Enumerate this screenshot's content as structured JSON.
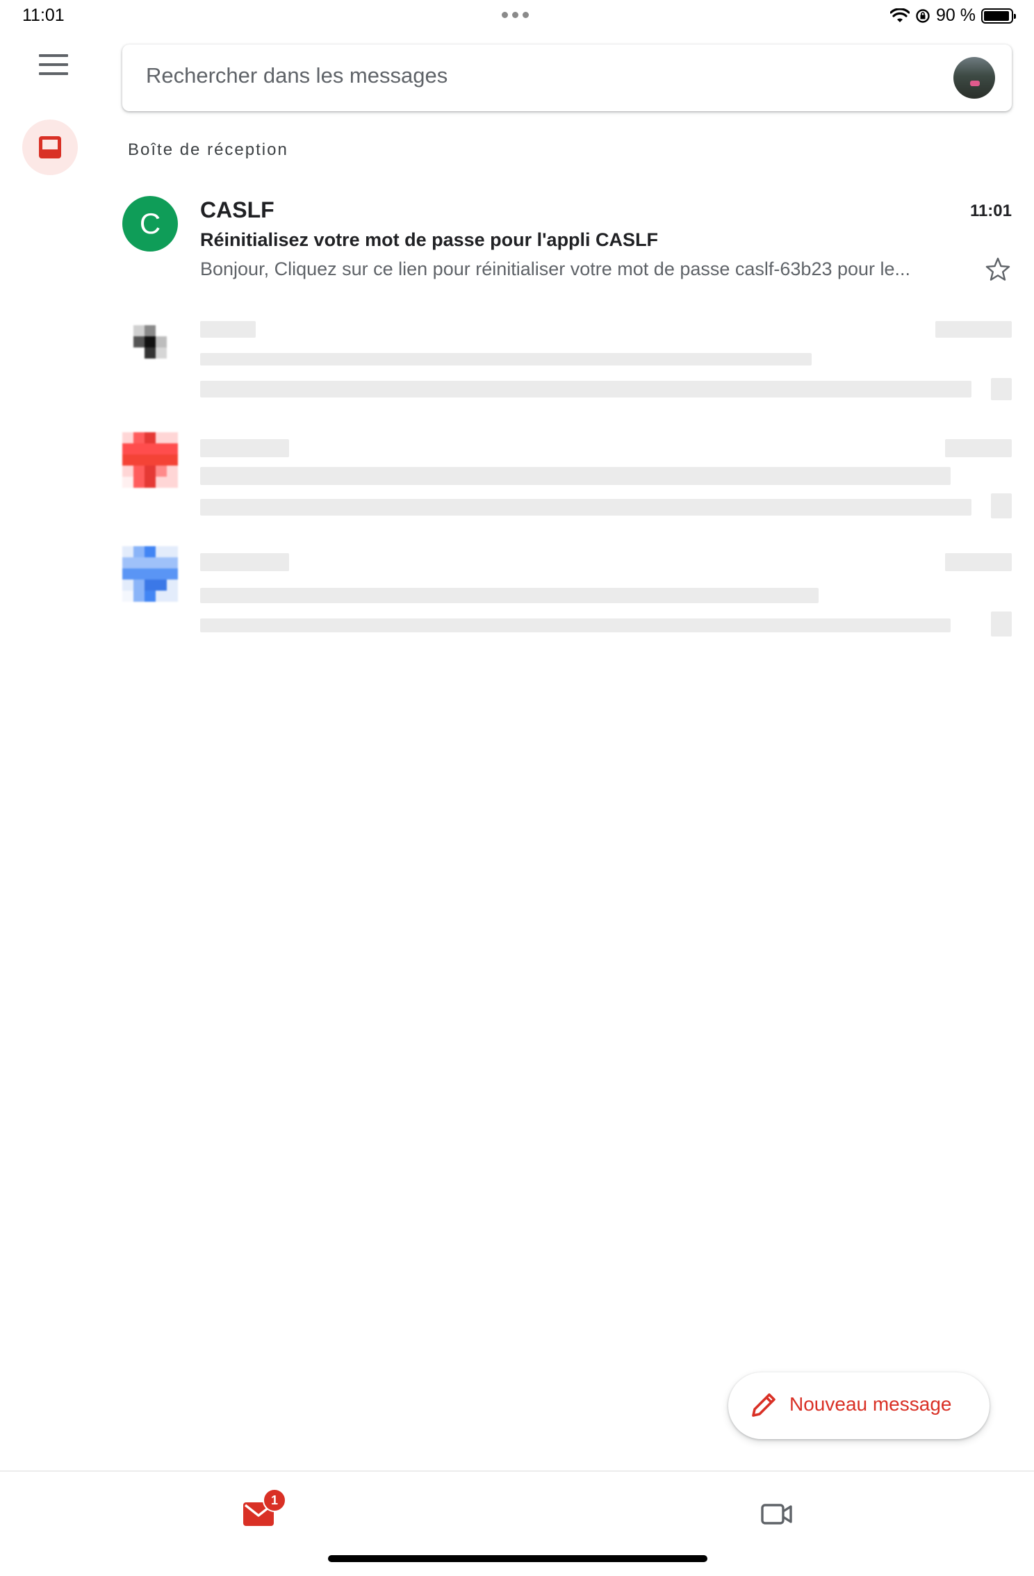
{
  "status_bar": {
    "time": "11:01",
    "battery_text": "90 %"
  },
  "search": {
    "placeholder": "Rechercher dans les messages"
  },
  "section_label": "Boîte de réception",
  "messages": [
    {
      "avatar_letter": "C",
      "avatar_color": "#0f9d58",
      "sender": "CASLF",
      "time": "11:01",
      "subject": "Réinitialisez votre mot de passe pour l'appli CASLF",
      "snippet": "Bonjour, Cliquez sur ce lien pour réinitialiser votre mot de passe caslf-63b23 pour le..."
    }
  ],
  "compose": {
    "label": "Nouveau message"
  },
  "bottom_nav": {
    "mail_badge": "1"
  },
  "colors": {
    "accent": "#d93025",
    "inbox_highlight": "#fce8e6"
  },
  "icons": [
    "menu-icon",
    "inbox-icon",
    "star-icon",
    "pencil-icon",
    "mail-icon",
    "video-icon",
    "wifi-icon",
    "battery-icon"
  ]
}
